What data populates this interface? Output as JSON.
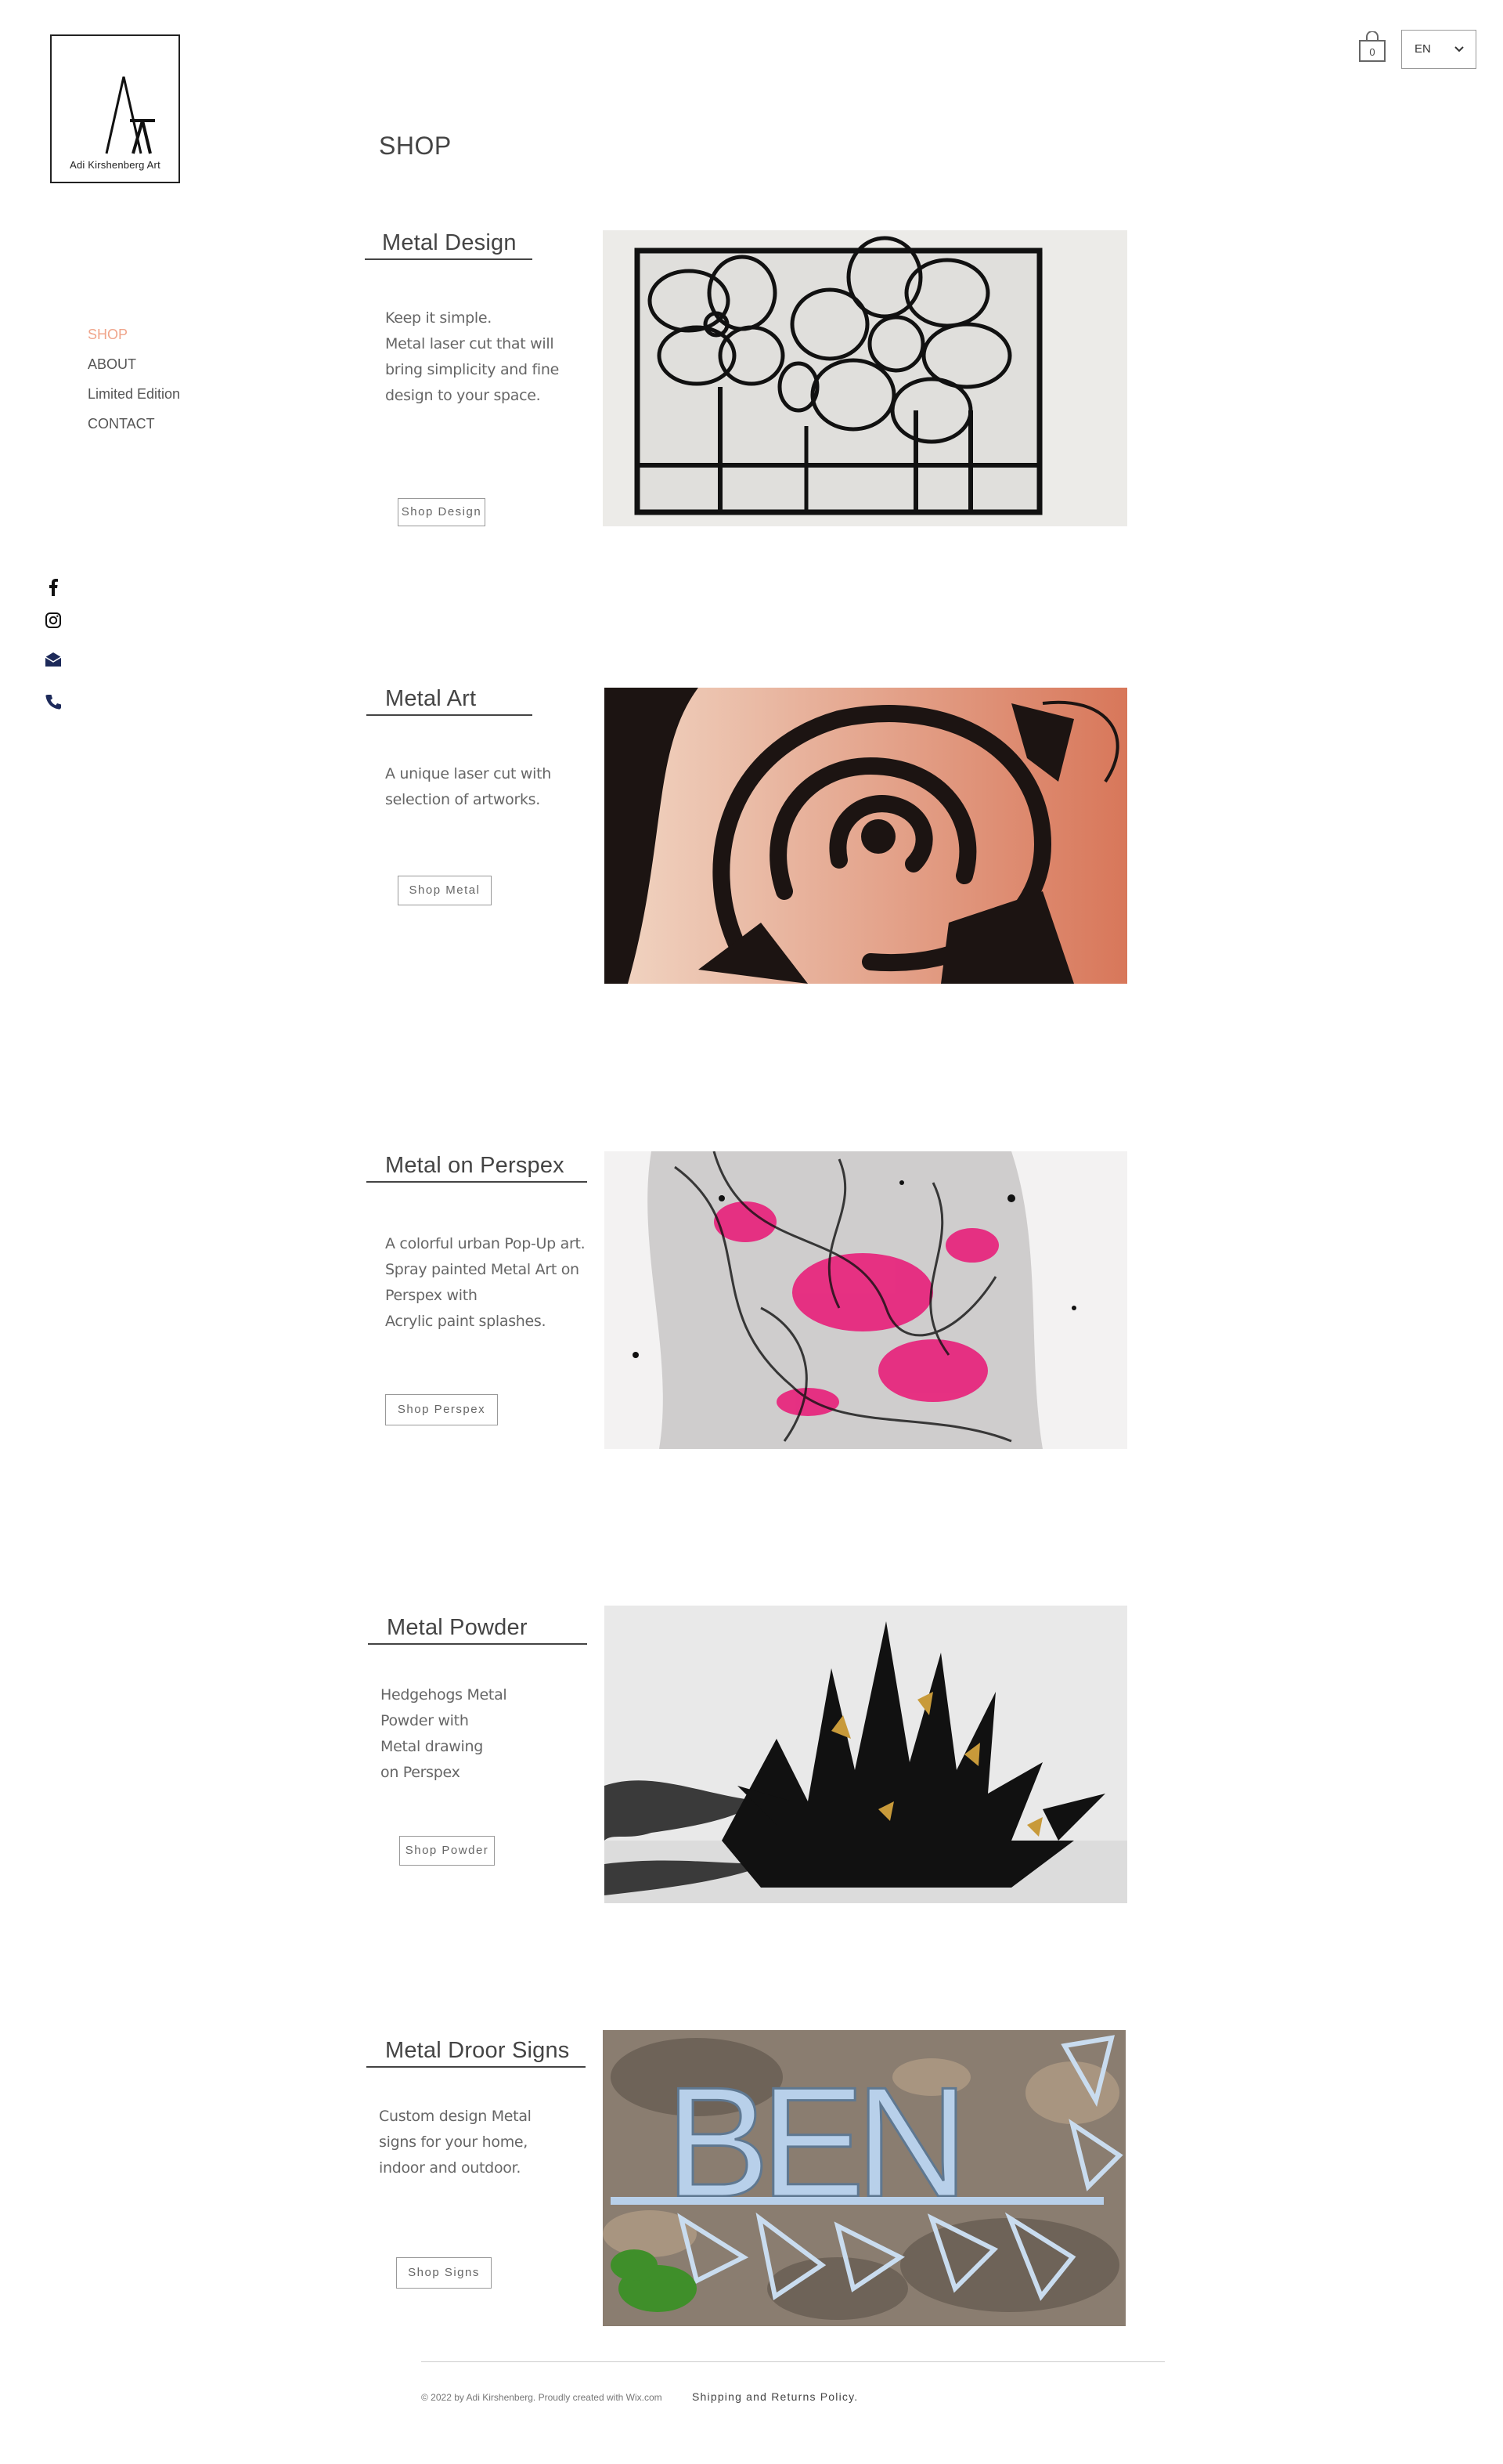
{
  "logo": {
    "text": "Adi Kirshenberg Art"
  },
  "nav": {
    "items": [
      "SHOP",
      "ABOUT",
      "Limited Edition",
      "CONTACT"
    ]
  },
  "header": {
    "cart_count": "0",
    "language": "EN"
  },
  "page": {
    "title": "SHOP"
  },
  "sections": [
    {
      "title": "Metal Design",
      "desc": [
        "Keep it simple.",
        "Metal laser cut that will",
        "bring simplicity and fine",
        "design to your space."
      ],
      "button": "Shop Design"
    },
    {
      "title": "Metal Art",
      "desc": [
        "A unique laser cut with",
        "selection of artworks."
      ],
      "button": "Shop Metal"
    },
    {
      "title": "Metal on Perspex",
      "desc": [
        "A colorful urban Pop-Up art.",
        "Spray painted Metal Art on",
        "Perspex with",
        "Acrylic paint splashes."
      ],
      "button": "Shop Perspex"
    },
    {
      "title": "Metal Powder",
      "desc": [
        "Hedgehogs Metal",
        "Powder with",
        "Metal drawing",
        "on Perspex"
      ],
      "button": "Shop Powder"
    },
    {
      "title": "Metal Droor Signs",
      "desc": [
        "Custom design Metal",
        "signs for your home,",
        "indoor and outdoor."
      ],
      "button": "Shop Signs"
    }
  ],
  "artworks": {
    "sign_text": "BEN"
  },
  "footer": {
    "copyright": "© 2022 by Adi Kirshenberg. Proudly created with Wix.com",
    "policy": "Shipping and Returns Policy."
  },
  "colors": {
    "accent": "#f0a58b",
    "text": "#444444"
  }
}
